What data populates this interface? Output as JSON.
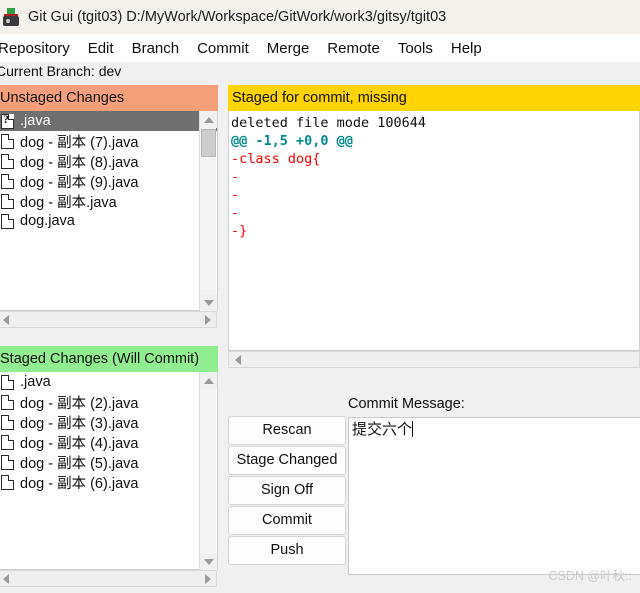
{
  "window": {
    "title": "Git Gui (tgit03) D:/MyWork/Workspace/GitWork/work3/gitsy/tgit03",
    "icon": "git-gui-icon"
  },
  "menubar": {
    "items": [
      {
        "label": "Repository"
      },
      {
        "label": "Edit"
      },
      {
        "label": "Branch"
      },
      {
        "label": "Commit"
      },
      {
        "label": "Merge"
      },
      {
        "label": "Remote"
      },
      {
        "label": "Tools"
      },
      {
        "label": "Help"
      }
    ]
  },
  "branch": {
    "text": "Current Branch: dev"
  },
  "unstaged": {
    "header": "Unstaged Changes",
    "files": [
      {
        "name": ".java",
        "icon": "unknown-file-icon",
        "selected": true
      },
      {
        "name": "dog - 副本 (7).java",
        "icon": "file-icon",
        "selected": false
      },
      {
        "name": "dog - 副本 (8).java",
        "icon": "file-icon",
        "selected": false
      },
      {
        "name": "dog - 副本 (9).java",
        "icon": "file-icon",
        "selected": false
      },
      {
        "name": "dog - 副本.java",
        "icon": "file-icon",
        "selected": false
      },
      {
        "name": "dog.java",
        "icon": "file-icon",
        "selected": false
      }
    ]
  },
  "staged": {
    "header": "Staged Changes (Will Commit)",
    "files": [
      {
        "name": ".java",
        "icon": "file-icon",
        "selected": false
      },
      {
        "name": "dog - 副本 (2).java",
        "icon": "file-icon",
        "selected": false
      },
      {
        "name": "dog - 副本 (3).java",
        "icon": "file-icon",
        "selected": false
      },
      {
        "name": "dog - 副本 (4).java",
        "icon": "file-icon",
        "selected": false
      },
      {
        "name": "dog - 副本 (5).java",
        "icon": "file-icon",
        "selected": false
      },
      {
        "name": "dog - 副本 (6).java",
        "icon": "file-icon",
        "selected": false
      }
    ]
  },
  "diff": {
    "header": "Staged for commit, missing",
    "lines": [
      {
        "text": "deleted file mode 100644",
        "kind": "plain"
      },
      {
        "text": "@@ -1,5 +0,0 @@",
        "kind": "hunk"
      },
      {
        "text": "-class dog{",
        "kind": "del"
      },
      {
        "text": "-",
        "kind": "del"
      },
      {
        "text": "-",
        "kind": "del"
      },
      {
        "text": "-",
        "kind": "del"
      },
      {
        "text": "-}",
        "kind": "del"
      }
    ]
  },
  "buttons": {
    "rescan": "Rescan",
    "stage_changed": "Stage Changed",
    "sign_off": "Sign Off",
    "commit": "Commit",
    "push": "Push"
  },
  "commit_message": {
    "label": "Commit Message:",
    "value": "提交六个"
  },
  "watermark": {
    "text": "CSDN @叶秋::"
  },
  "colors": {
    "unstaged_header": "#f5a07a",
    "staged_header": "#90ee90",
    "diff_header": "#ffd400",
    "selection": "#707070",
    "diff_hunk": "#008b8b",
    "diff_delete": "#ff0000"
  }
}
